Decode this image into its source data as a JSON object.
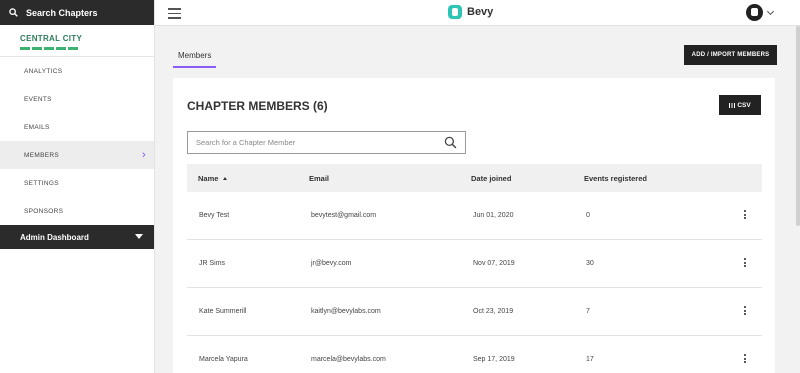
{
  "sidebar": {
    "search_label": "Search Chapters",
    "chapter_name": "CENTRAL CITY",
    "items": [
      {
        "label": "ANALYTICS"
      },
      {
        "label": "EVENTS"
      },
      {
        "label": "EMAILS"
      },
      {
        "label": "MEMBERS"
      },
      {
        "label": "SETTINGS"
      },
      {
        "label": "SPONSORS"
      }
    ],
    "admin_label": "Admin Dashboard"
  },
  "topbar": {
    "brand": "Bevy"
  },
  "header": {
    "tab_label": "Members",
    "import_button": "ADD / IMPORT MEMBERS"
  },
  "card": {
    "title": "CHAPTER MEMBERS (6)",
    "csv_button": "CSV",
    "search_placeholder": "Search for a Chapter Member",
    "columns": [
      "Name",
      "Email",
      "Date joined",
      "Events registered"
    ],
    "rows": [
      {
        "name": "Bevy Test",
        "email": "bevytest@gmail.com",
        "date": "Jun 01, 2020",
        "events": "0"
      },
      {
        "name": "JR Sims",
        "email": "jr@bevy.com",
        "date": "Nov 07, 2019",
        "events": "30"
      },
      {
        "name": "Kate Summerill",
        "email": "kaitlyn@bevylabs.com",
        "date": "Oct 23, 2019",
        "events": "7"
      },
      {
        "name": "Marcela Yapura",
        "email": "marcela@bevylabs.com",
        "date": "Sep 17, 2019",
        "events": "17"
      }
    ]
  },
  "colors": {
    "accent": "#8a5cf6",
    "chapter_green": "#3cb371",
    "dark": "#2b2b2b"
  }
}
